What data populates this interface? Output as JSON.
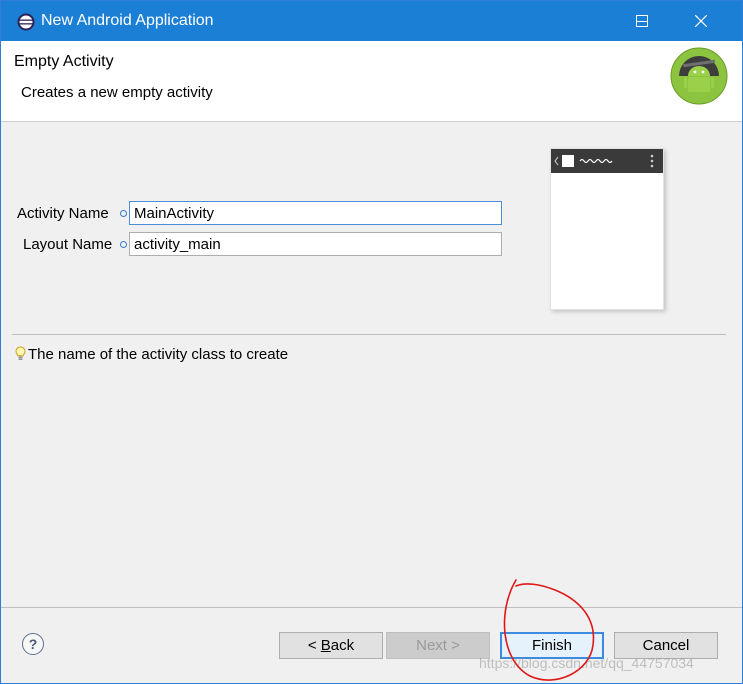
{
  "window": {
    "title": "New Android Application",
    "controls": {
      "minimize_icon": "minimize-icon",
      "maximize_icon": "maximize-icon",
      "close_icon": "close-icon"
    }
  },
  "header": {
    "title": "Empty Activity",
    "description": "Creates a new empty activity",
    "logo_icon": "android-logo-icon"
  },
  "form": {
    "activity_name_label": "Activity Name",
    "activity_name_value": "MainActivity",
    "layout_name_label": "Layout Name",
    "layout_name_value": "activity_main"
  },
  "hint": {
    "text": "The name of the activity class to create",
    "icon": "lightbulb-icon"
  },
  "footer": {
    "help_label": "?",
    "back_mnemonic": "B",
    "back_rest": "ack",
    "back_prefix": "< ",
    "next_label": "Next >",
    "finish_label": "Finish",
    "cancel_label": "Cancel"
  },
  "watermark": "https://blog.csdn.net/qq_44757034",
  "colors": {
    "titlebar": "#1b7fd6",
    "annotation": "#e01818",
    "android_green": "#8cc43f"
  }
}
